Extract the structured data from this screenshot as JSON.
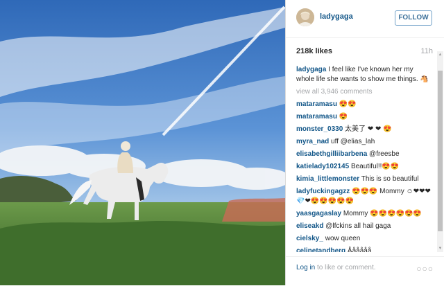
{
  "post": {
    "author": "ladygaga",
    "follow_label": "FOLLOW",
    "likes": "218k likes",
    "time_ago": "11h",
    "caption_user": "ladygaga",
    "caption_text": "I feel like I've known her my whole life she wants to show me things. 🐴",
    "view_all": "view all 3,946 comments"
  },
  "comments": [
    {
      "user": "mataramasu",
      "text": "😍😍"
    },
    {
      "user": "mataramasu",
      "text": "😍"
    },
    {
      "user": "monster_0330",
      "text": "太美了 ❤ ❤ 😍"
    },
    {
      "user": "myra_nad",
      "text": "uff @elias_lah"
    },
    {
      "user": "elisabethgilliibarbena",
      "text": "@freesbe"
    },
    {
      "user": "katielady102145",
      "text": "Beautiful!!😍😍"
    },
    {
      "user": "kimia_littlemonster",
      "text": "This is so beautiful"
    },
    {
      "user": "ladyfuckingagzz",
      "text": "😍😍😍 Mommy ☺❤❤❤💎❤😍😍😍😍😍"
    },
    {
      "user": "yaasgagaslay",
      "text": "Mommy 😍😍😍😍😍😍"
    },
    {
      "user": "eliseakd",
      "text": "@lfckins all hail gaga"
    },
    {
      "user": "cielsky_",
      "text": "wow queen"
    },
    {
      "user": "celinetandberg",
      "text": "Åååååå"
    }
  ],
  "footer": {
    "login_link": "Log in",
    "login_rest": " to like or comment.",
    "more": "○○○"
  },
  "icons": {
    "more_options": "ellipsis-icon"
  }
}
